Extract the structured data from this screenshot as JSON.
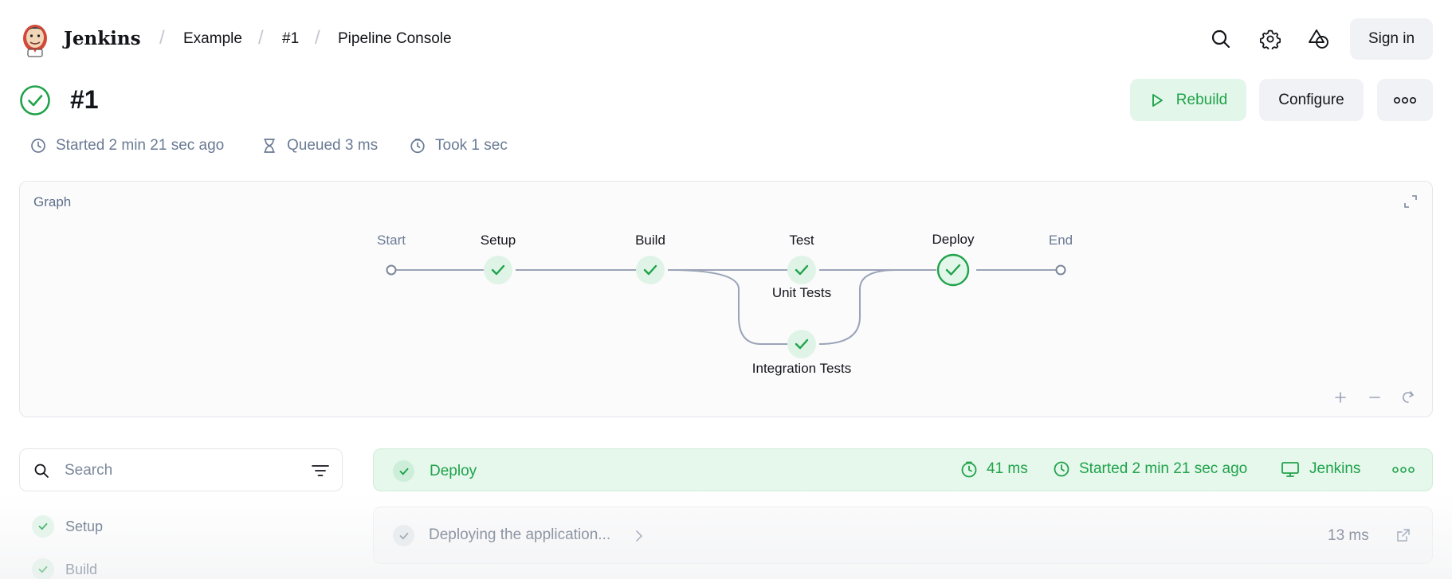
{
  "header": {
    "brand": "Jenkins",
    "breadcrumbs": [
      "Example",
      "#1",
      "Pipeline Console"
    ],
    "icons": [
      "search-icon",
      "gear-icon",
      "shapes-icon"
    ],
    "sign_in": "Sign in"
  },
  "build": {
    "title": "#1",
    "status": "success",
    "rebuild_label": "Rebuild",
    "configure_label": "Configure",
    "started": "Started 2 min 21 sec ago",
    "queued": "Queued 3 ms",
    "took": "Took 1 sec"
  },
  "graph": {
    "title": "Graph",
    "stages": {
      "start": "Start",
      "setup": "Setup",
      "build": "Build",
      "test": "Test",
      "unit_tests": "Unit Tests",
      "integration_tests": "Integration Tests",
      "deploy": "Deploy",
      "end": "End"
    }
  },
  "sidebar": {
    "search_placeholder": "Search",
    "stages": [
      "Setup",
      "Build"
    ]
  },
  "selected_stage": {
    "name": "Deploy",
    "duration": "41 ms",
    "started": "Started 2 min 21 sec ago",
    "agent": "Jenkins"
  },
  "steps": [
    {
      "label": "Deploying the application...",
      "duration": "13 ms"
    }
  ],
  "colors": {
    "success": "#1fa34a",
    "success_bg": "#e3f6ea",
    "muted": "#6a7a94"
  }
}
